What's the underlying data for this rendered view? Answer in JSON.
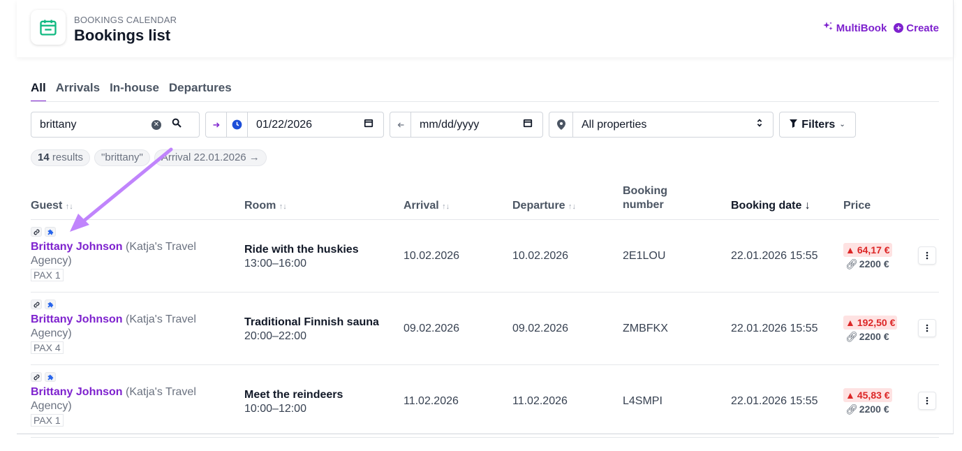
{
  "header": {
    "breadcrumb": "BOOKINGS CALENDAR",
    "title": "Bookings list",
    "icon": "calendar-icon",
    "actions": {
      "multibook": "MultiBook",
      "create": "Create"
    },
    "accent": "#7e22ce",
    "icon_color": "#10b981"
  },
  "tabs": [
    {
      "label": "All",
      "active": true
    },
    {
      "label": "Arrivals"
    },
    {
      "label": "In-house"
    },
    {
      "label": "Departures"
    }
  ],
  "filters": {
    "search_value": "brittany",
    "arrival_date": "01/22/2026",
    "departure_placeholder": "mm/dd/yyyy",
    "property": "All properties",
    "filters_label": "Filters"
  },
  "chips": {
    "results_count": "14",
    "results_label": "results",
    "query": "\"brittany\"",
    "arrival": "Arrival 22.01.2026 →"
  },
  "table": {
    "columns": {
      "guest": "Guest",
      "room": "Room",
      "arrival": "Arrival",
      "departure": "Departure",
      "booking_number_1": "Booking",
      "booking_number_2": "number",
      "booking_date": "Booking date",
      "booking_date_sort": "↓",
      "price": "Price"
    },
    "rows": [
      {
        "guest": "Brittany Johnson",
        "agency_1": " (Katja's Travel",
        "agency_2": "Agency)",
        "pax": "PAX 1",
        "room": "Ride with the huskies",
        "time": "13:00–16:00",
        "arrival": "10.02.2026",
        "departure": "10.02.2026",
        "booking_number": "2E1LOU",
        "booking_date": "22.01.2026 15:55",
        "price_due": "64,17 €",
        "price_paid": "2200 €"
      },
      {
        "guest": "Brittany Johnson",
        "agency_1": " (Katja's Travel",
        "agency_2": "Agency)",
        "pax": "PAX 4",
        "room": "Traditional Finnish sauna",
        "time": "20:00–22:00",
        "arrival": "09.02.2026",
        "departure": "09.02.2026",
        "booking_number": "ZMBFKX",
        "booking_date": "22.01.2026 15:55",
        "price_due": "192,50 €",
        "price_paid": "2200 €"
      },
      {
        "guest": "Brittany Johnson",
        "agency_1": " (Katja's Travel",
        "agency_2": "Agency)",
        "pax": "PAX 1",
        "room": "Meet the reindeers",
        "time": "10:00–12:00",
        "arrival": "11.02.2026",
        "departure": "11.02.2026",
        "booking_number": "L4SMPI",
        "booking_date": "22.01.2026 15:55",
        "price_due": "45,83 €",
        "price_paid": "2200 €"
      }
    ]
  },
  "annotation": {
    "arrow_color": "#c084fc"
  }
}
